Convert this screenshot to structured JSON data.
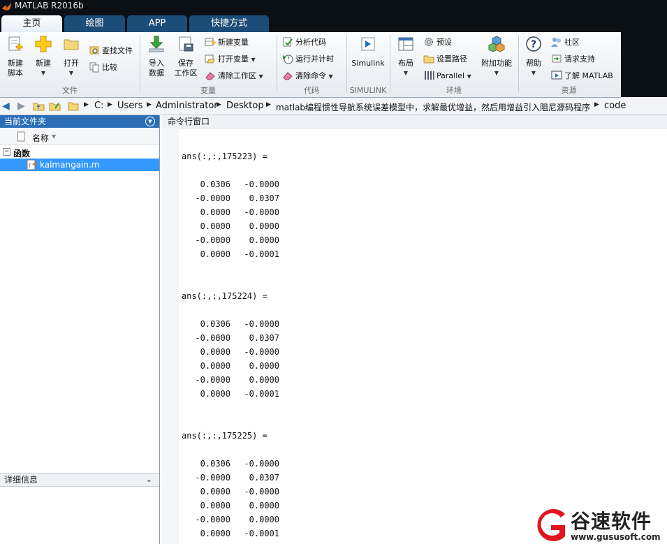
{
  "window": {
    "title": "MATLAB R2016b"
  },
  "tabs": [
    {
      "label": "主页",
      "active": true
    },
    {
      "label": "绘图",
      "active": false
    },
    {
      "label": "APP",
      "active": false
    },
    {
      "label": "快捷方式",
      "active": false
    }
  ],
  "ribbon": {
    "file": {
      "group_label": "文件",
      "new_script": "新建\n脚本",
      "new": "新建",
      "open": "打开",
      "find_files": "查找文件",
      "compare": "比较"
    },
    "variable": {
      "group_label": "变量",
      "import_data": "导入\n数据",
      "save_workspace": "保存\n工作区",
      "new_variable": "新建变量",
      "open_variable": "打开变量",
      "clear_workspace": "清除工作区"
    },
    "code": {
      "group_label": "代码",
      "analyze_code": "分析代码",
      "run_time": "运行并计时",
      "clear_commands": "清除命令"
    },
    "simulink": {
      "group_label": "SIMULINK",
      "simulink": "Simulink"
    },
    "environment": {
      "group_label": "环境",
      "layout": "布局",
      "preferences": "预设",
      "set_path": "设置路径",
      "parallel": "Parallel",
      "addons": "附加功能"
    },
    "resources": {
      "group_label": "资源",
      "help": "帮助",
      "community": "社区",
      "request_support": "请求支持",
      "learn_matlab": "了解 MATLAB"
    }
  },
  "address": {
    "crumbs": [
      "C:",
      "Users",
      "Administrator",
      "Desktop",
      "matlab编程惯性导航系统误差模型中，求解最优增益，然后用增益引入阻尼源码程序",
      "code"
    ]
  },
  "current_folder": {
    "title": "当前文件夹",
    "col_name": "名称",
    "group": "函数",
    "file": "kalmangain.m",
    "details_title": "详细信息"
  },
  "command_window": {
    "title": "命令行窗口",
    "blocks": [
      {
        "header": "ans(:,:,175223) =",
        "rows": [
          [
            "0.0306",
            "-0.0000"
          ],
          [
            "-0.0000",
            "0.0307"
          ],
          [
            "0.0000",
            "-0.0000"
          ],
          [
            "0.0000",
            "0.0000"
          ],
          [
            "-0.0000",
            "0.0000"
          ],
          [
            "0.0000",
            "-0.0001"
          ]
        ]
      },
      {
        "header": "ans(:,:,175224) =",
        "rows": [
          [
            "0.0306",
            "-0.0000"
          ],
          [
            "-0.0000",
            "0.0307"
          ],
          [
            "0.0000",
            "-0.0000"
          ],
          [
            "0.0000",
            "0.0000"
          ],
          [
            "-0.0000",
            "0.0000"
          ],
          [
            "0.0000",
            "-0.0001"
          ]
        ]
      },
      {
        "header": "ans(:,:,175225) =",
        "rows": [
          [
            "0.0306",
            "-0.0000"
          ],
          [
            "-0.0000",
            "0.0307"
          ],
          [
            "0.0000",
            "-0.0000"
          ],
          [
            "0.0000",
            "0.0000"
          ],
          [
            "-0.0000",
            "0.0000"
          ],
          [
            "0.0000",
            "-0.0001"
          ]
        ]
      }
    ]
  },
  "watermark": {
    "brand": "谷速软件",
    "url": "www.gususoft.com",
    "color": "#e0141e"
  }
}
